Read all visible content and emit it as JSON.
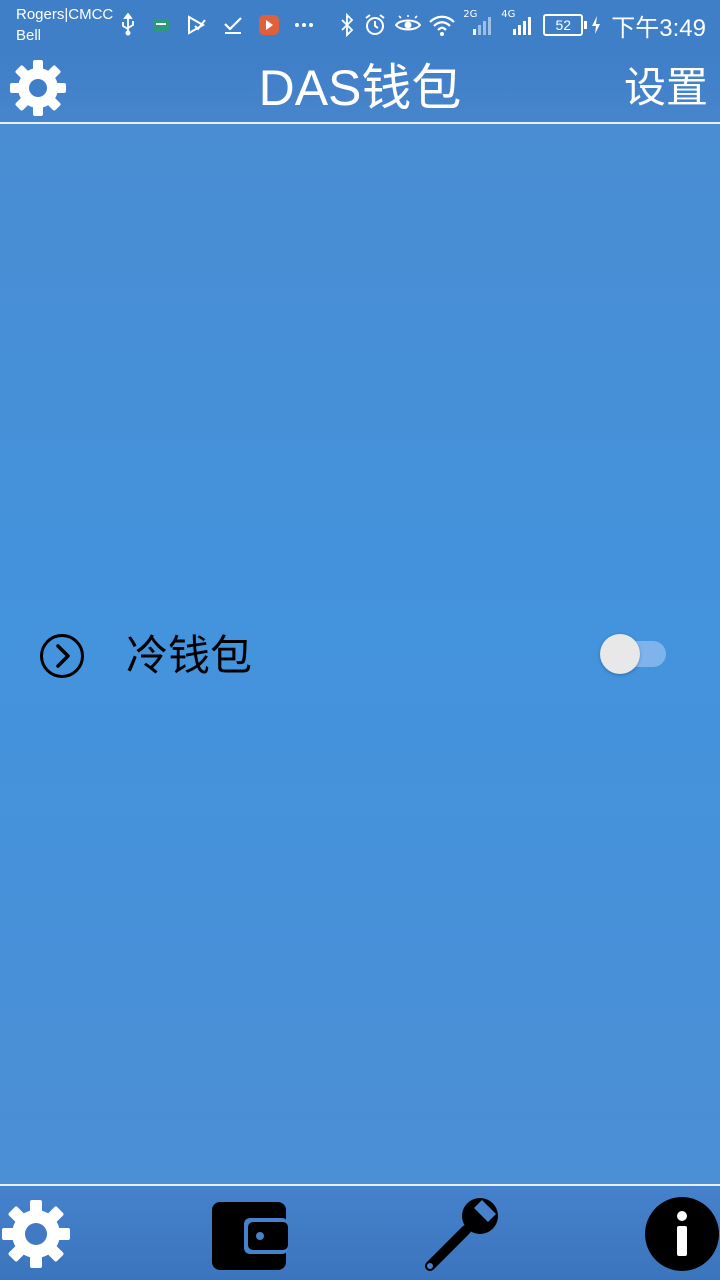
{
  "status_bar": {
    "carrier_line1": "Rogers|CMCC",
    "carrier_line2": "Bell",
    "network_2g": "2G",
    "network_4g": "4G",
    "battery": "52",
    "time": "下午3:49"
  },
  "header": {
    "title": "DAS钱包",
    "settings_label": "设置"
  },
  "main": {
    "cold_wallet_label": "冷钱包",
    "cold_wallet_toggle_on": false
  },
  "colors": {
    "background": "#4393dd",
    "header": "#3f7fc8",
    "toggle_track": "#7fb3ec",
    "toggle_knob": "#e8e8e8"
  },
  "icons": {
    "header_left": "gear-icon",
    "row_left": "chevron-right-circle-icon",
    "bottom": [
      "gear-icon",
      "wallet-icon",
      "wrench-icon",
      "info-icon"
    ]
  }
}
